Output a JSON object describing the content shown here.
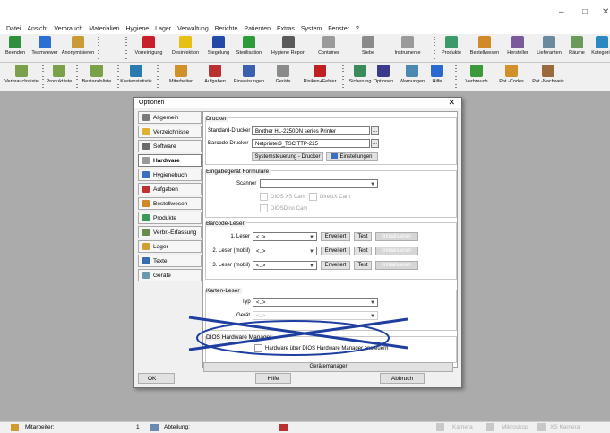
{
  "window": {
    "minimize": "–",
    "maximize": "□",
    "close": "✕"
  },
  "menu": [
    "Datei",
    "Ansicht",
    "Verbrauch",
    "Materialien",
    "Hygiene",
    "Lager",
    "Verwaltung",
    "Berichte",
    "Patienten",
    "Extras",
    "System",
    "Fenster",
    "?"
  ],
  "toolbar1": [
    {
      "label": "Beenden",
      "color": "#2f8f3a"
    },
    {
      "label": "Teamviewer",
      "color": "#2a6fd1"
    },
    {
      "label": "Anonymisieren",
      "color": "#c99a36"
    },
    {
      "label": "Vorreinigung",
      "color": "#c8202a"
    },
    {
      "label": "Desinfektion",
      "color": "#e6c012"
    },
    {
      "label": "Siegelung",
      "color": "#2448a8"
    },
    {
      "label": "Sterilisation",
      "color": "#2e9a3a"
    },
    {
      "label": "Hygiene Report",
      "color": "#5a5a5a"
    },
    {
      "label": "Container",
      "color": "#9a9a9a"
    },
    {
      "label": "Siebe",
      "color": "#8a8a8a"
    },
    {
      "label": "Instrumente",
      "color": "#9a9a9a"
    },
    {
      "label": "Produkte",
      "color": "#3a9a6a"
    },
    {
      "label": "Bestellwesen",
      "color": "#d08a2a"
    },
    {
      "label": "Hersteller",
      "color": "#7a5a9a"
    },
    {
      "label": "Lieferanten",
      "color": "#6a8aa0"
    },
    {
      "label": "Räume",
      "color": "#6a9a5a"
    },
    {
      "label": "Kategorie",
      "color": "#2a8ac0"
    }
  ],
  "toolbar2": [
    {
      "label": "Verbrauchsliste",
      "color": "#7aa04a"
    },
    {
      "label": "Produktliste",
      "color": "#7aa04a"
    },
    {
      "label": "Bestandsliste",
      "color": "#7aa04a"
    },
    {
      "label": "Kostenstatistik",
      "color": "#2a7ab0"
    },
    {
      "label": "Mitarbeiter",
      "color": "#d0902a"
    },
    {
      "label": "Aufgaben",
      "color": "#b83030"
    },
    {
      "label": "Einweisungen",
      "color": "#3a60b0"
    },
    {
      "label": "Geräte",
      "color": "#8a8a8a"
    },
    {
      "label": "Risiken+Fehler",
      "color": "#c02020"
    },
    {
      "label": "Sicherung",
      "color": "#3a8a5a"
    },
    {
      "label": "Optionen",
      "color": "#3a3a8a"
    },
    {
      "label": "Warnungen",
      "color": "#4a8ab0"
    },
    {
      "label": "Hilfe",
      "color": "#2a6ad0"
    },
    {
      "label": "Verbrauch",
      "color": "#3a9a3a"
    },
    {
      "label": "Pat.-Codes",
      "color": "#d0902a"
    },
    {
      "label": "Pat.-Nachweis",
      "color": "#9a6a3a"
    }
  ],
  "dialog": {
    "title": "Optionen",
    "close": "✕",
    "nav": [
      {
        "label": "Allgemein",
        "color": "#7a7a7a"
      },
      {
        "label": "Verzeichnisse",
        "color": "#e0b030"
      },
      {
        "label": "Software",
        "color": "#6a6a6a"
      },
      {
        "label": "Hardware",
        "color": "#9a9a9a"
      },
      {
        "label": "Hygienebuch",
        "color": "#3a70c0"
      },
      {
        "label": "Aufgaben",
        "color": "#c03030"
      },
      {
        "label": "Bestellwesen",
        "color": "#d08a2a"
      },
      {
        "label": "Produkte",
        "color": "#3a9a5a"
      },
      {
        "label": "Verbr.-Erfassung",
        "color": "#6a8a4a"
      },
      {
        "label": "Lager",
        "color": "#d0a030"
      },
      {
        "label": "Texte",
        "color": "#3a6ab0"
      },
      {
        "label": "Geräte",
        "color": "#6a9ab0"
      }
    ],
    "active_nav": "Hardware",
    "drucker": {
      "title": "Drucker",
      "standard_label": "Standard-Drucker",
      "standard_value": "Brother HL-2250DN series Printer",
      "barcode_label": "Barcode-Drucker",
      "barcode_value": "Netprinter3_TSC TTP-225",
      "dots": "...",
      "systemsteuerung": "Systemsteuerung - Drucker",
      "einstellungen": "Einstellungen"
    },
    "eingabe": {
      "title": "Eingabegerät Formulare",
      "scanner_label": "Scanner",
      "scanner_value": "",
      "opt1": "DIOS XS Cam",
      "opt2": "DirectX Cam",
      "opt3": "DIOSDino Cam"
    },
    "barcode": {
      "title": "Barcode-Leser",
      "rows": [
        {
          "label": "1. Leser",
          "value": "<..>"
        },
        {
          "label": "2. Leser (mobil)",
          "value": "<..>"
        },
        {
          "label": "3. Leser (mobil)",
          "value": "<..>"
        }
      ],
      "erweitert": "Erweitert",
      "test": "Test",
      "dis": "Initialisieren"
    },
    "karten": {
      "title": "Karten-Leser",
      "typ_label": "Typ",
      "typ_value": "<..>",
      "geraet_label": "Gerät",
      "geraet_value": "<..>"
    },
    "hwm": {
      "title": "DIOS Hardware Manager",
      "checkbox": "Hardware über DIOS Hardware Manager ansteuern",
      "button": "Gerätemanager"
    },
    "ok": "OK",
    "hilfe": "Hilfe",
    "abbruch": "Abbruch"
  },
  "status": {
    "mitarbeiter": "Mitarbeiter:",
    "nummer": "1",
    "abteilung": "Abteilung:",
    "kamera": "Kamera",
    "mikroskop": "Mikroskop",
    "xs_kamera": "XS Kamera"
  },
  "colors": {
    "background": "#ababab",
    "annotation": "#1f3fa0"
  }
}
